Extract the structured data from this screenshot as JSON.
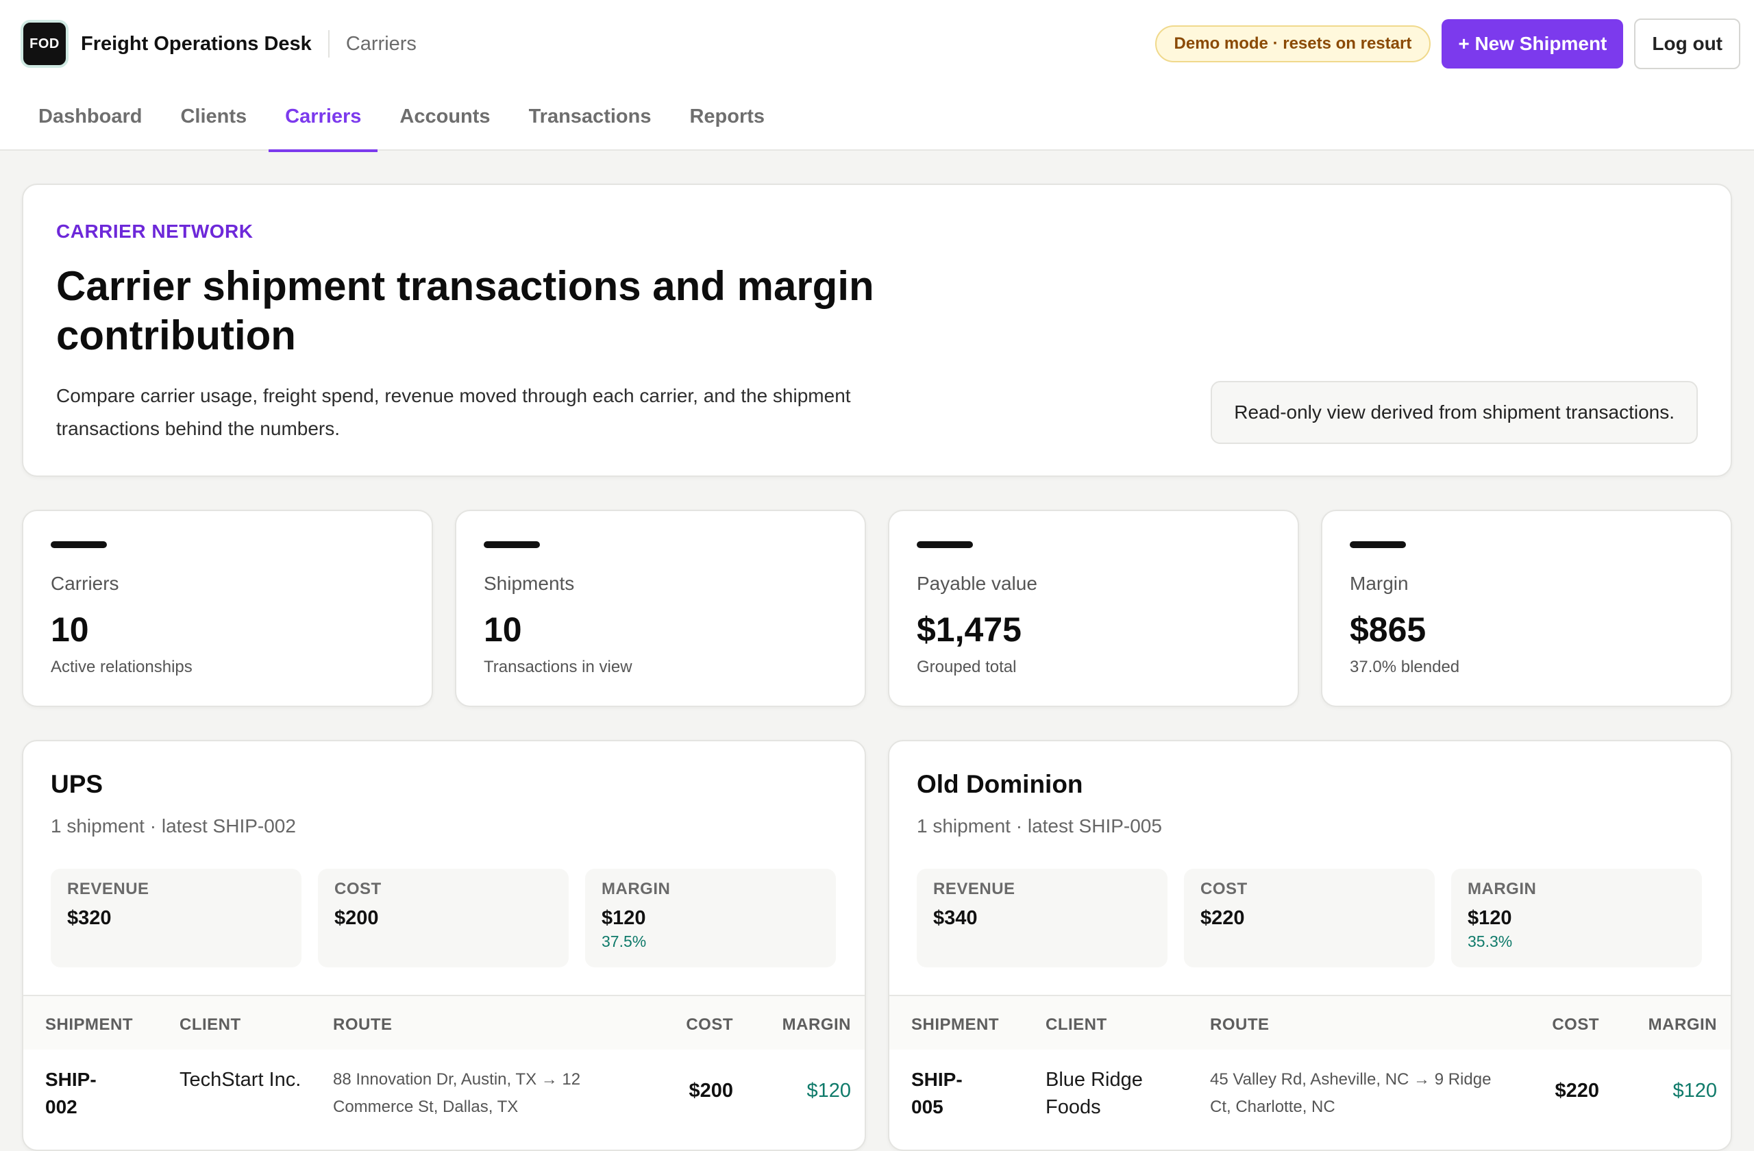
{
  "header": {
    "logo_text": "FOD",
    "app_name": "Freight Operations Desk",
    "breadcrumb": "Carriers",
    "demo_badge": "Demo mode · resets on restart",
    "new_shipment_label": "+ New Shipment",
    "logout_label": "Log out"
  },
  "nav": {
    "tabs": [
      {
        "label": "Dashboard"
      },
      {
        "label": "Clients"
      },
      {
        "label": "Carriers",
        "active": true
      },
      {
        "label": "Accounts"
      },
      {
        "label": "Transactions"
      },
      {
        "label": "Reports"
      }
    ]
  },
  "hero": {
    "eyebrow": "CARRIER NETWORK",
    "title": "Carrier shipment transactions and margin contribution",
    "description": "Compare carrier usage, freight spend, revenue moved through each carrier, and the shipment transactions behind the numbers.",
    "note": "Read-only view derived from shipment transactions."
  },
  "stats": [
    {
      "label": "Carriers",
      "value": "10",
      "sub": "Active relationships"
    },
    {
      "label": "Shipments",
      "value": "10",
      "sub": "Transactions in view"
    },
    {
      "label": "Payable value",
      "value": "$1,475",
      "sub": "Grouped total"
    },
    {
      "label": "Margin",
      "value": "$865",
      "sub": "37.0% blended"
    }
  ],
  "table_headers": {
    "shipment": "SHIPMENT",
    "client": "CLIENT",
    "route": "ROUTE",
    "cost": "COST",
    "margin": "MARGIN"
  },
  "metric_labels": {
    "revenue": "REVENUE",
    "cost": "COST",
    "margin": "MARGIN"
  },
  "carriers": [
    {
      "name": "UPS",
      "meta": "1 shipment · latest SHIP-002",
      "revenue": "$320",
      "cost": "$200",
      "margin": "$120",
      "margin_pct": "37.5%",
      "rows": [
        {
          "shipment": "SHIP-002",
          "client": "TechStart Inc.",
          "route": "88 Innovation Dr, Austin, TX → 12 Commerce St, Dallas, TX",
          "cost": "$200",
          "margin": "$120"
        }
      ]
    },
    {
      "name": "Old Dominion",
      "meta": "1 shipment · latest SHIP-005",
      "revenue": "$340",
      "cost": "$220",
      "margin": "$120",
      "margin_pct": "35.3%",
      "rows": [
        {
          "shipment": "SHIP-005",
          "client": "Blue Ridge Foods",
          "route": "45 Valley Rd, Asheville, NC → 9 Ridge Ct, Charlotte, NC",
          "cost": "$220",
          "margin": "$120"
        }
      ]
    }
  ],
  "colors": {
    "accent": "#7c3aed",
    "positive": "#0f7a6a",
    "badge_bg": "#fff8dc",
    "badge_text": "#8a4a05"
  }
}
